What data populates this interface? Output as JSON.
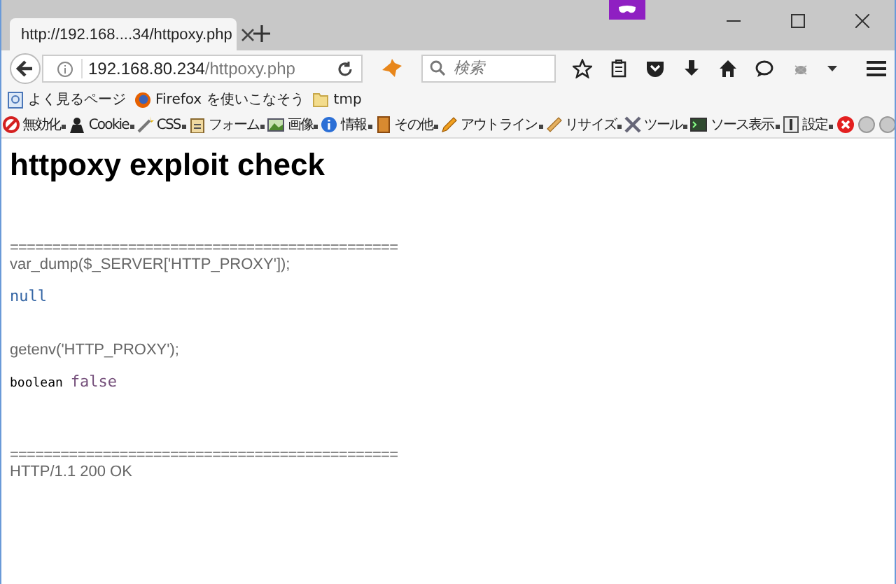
{
  "tabs": [
    {
      "title": "http://192.168....34/httpoxy.php",
      "selected": true
    }
  ],
  "window": {
    "private": true
  },
  "address": {
    "host": "192.168.80.234",
    "path": "/httpoxy.php"
  },
  "search": {
    "placeholder": "検索"
  },
  "bookmarks": [
    {
      "label": "よく見るページ"
    },
    {
      "label": "Firefox を使いこなそう"
    },
    {
      "label": "tmp"
    }
  ],
  "dev_toolbar": [
    {
      "label": "無効化"
    },
    {
      "label": "Cookie"
    },
    {
      "label": "CSS"
    },
    {
      "label": "フォーム"
    },
    {
      "label": "画像"
    },
    {
      "label": "情報"
    },
    {
      "label": "その他"
    },
    {
      "label": "アウトライン"
    },
    {
      "label": "リサイズ"
    },
    {
      "label": "ツール"
    },
    {
      "label": "ソース表示"
    },
    {
      "label": "設定"
    }
  ],
  "page": {
    "heading": "httpoxy exploit check",
    "lines": [
      {
        "kind": "rule",
        "text": "=============================================="
      },
      {
        "kind": "code",
        "text": "var_dump($_SERVER['HTTP_PROXY']);"
      },
      {
        "kind": "null",
        "text": "null"
      },
      {
        "kind": "code",
        "text": "getenv('HTTP_PROXY');"
      },
      {
        "kind": "bool",
        "type": "boolean",
        "text": "false"
      },
      {
        "kind": "rule",
        "text": "=============================================="
      },
      {
        "kind": "code",
        "text": "HTTP/1.1 200 OK"
      }
    ]
  }
}
